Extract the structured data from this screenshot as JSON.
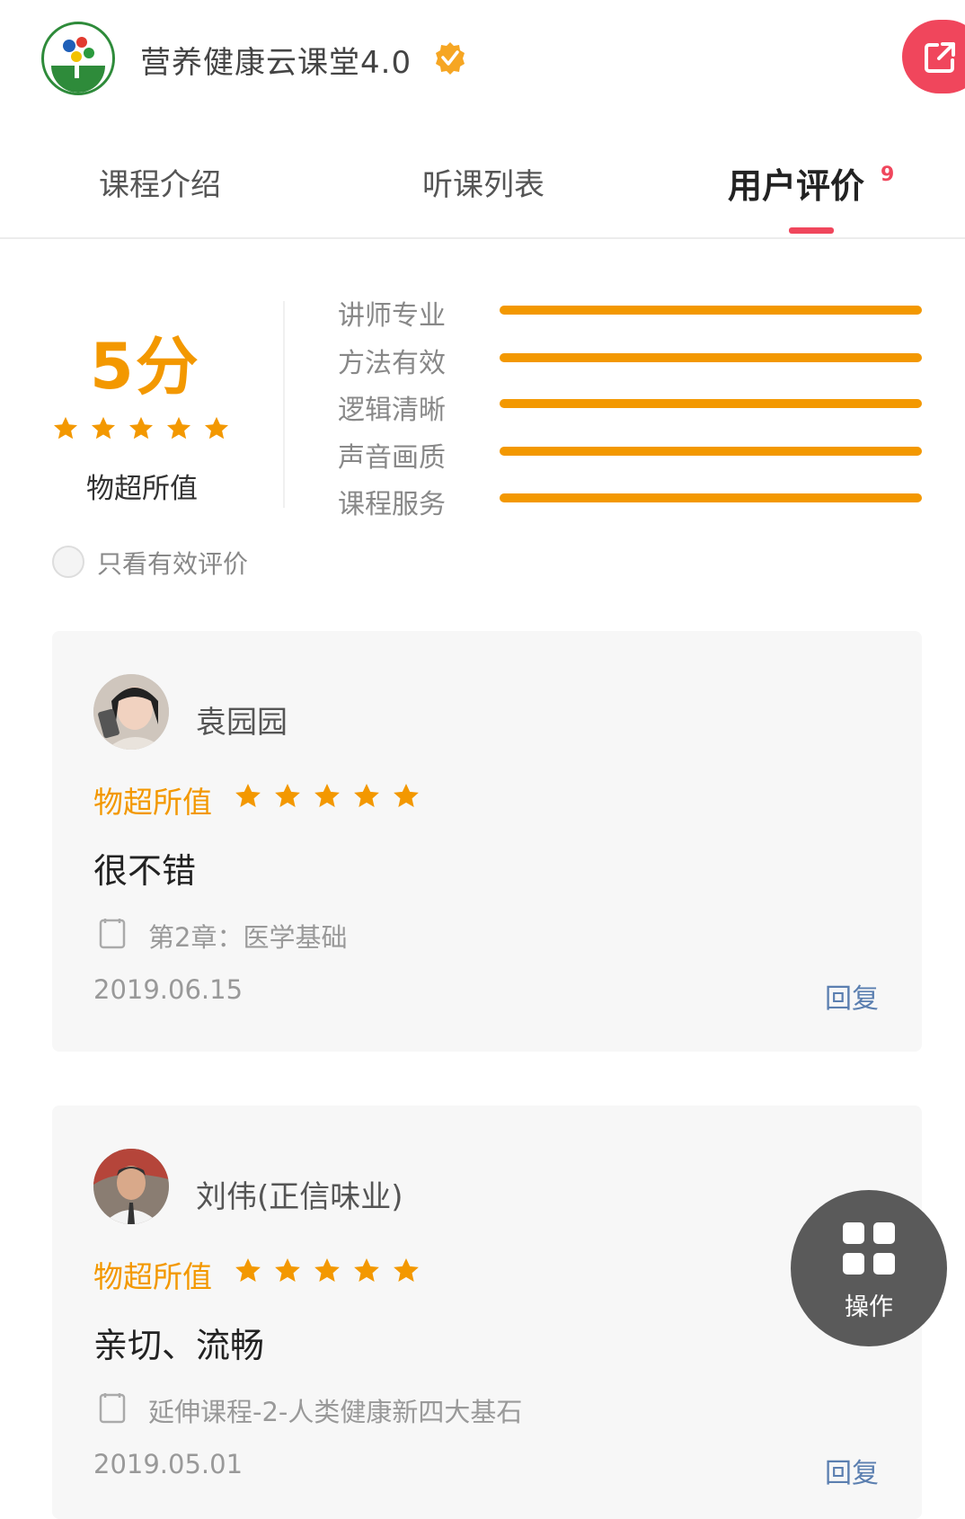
{
  "header": {
    "title": "营养健康云课堂4.0"
  },
  "tabs": [
    {
      "label": "课程介绍"
    },
    {
      "label": "听课列表"
    },
    {
      "label": "用户评价",
      "badge": "9",
      "active": true
    }
  ],
  "summary": {
    "score": "5分",
    "stars": 5,
    "label": "物超所值",
    "metrics": [
      {
        "label": "讲师专业",
        "value": 1.0
      },
      {
        "label": "方法有效",
        "value": 1.0
      },
      {
        "label": "逻辑清晰",
        "value": 1.0
      },
      {
        "label": "声音画质",
        "value": 1.0
      },
      {
        "label": "课程服务",
        "value": 1.0
      }
    ],
    "filter_label": "只看有效评价"
  },
  "reviews": [
    {
      "user": "袁园园",
      "tag": "物超所值",
      "stars": 5,
      "text": "很不错",
      "chapter": "第2章：医学基础",
      "date": "2019.06.15",
      "reply": "回复"
    },
    {
      "user": "刘伟(正信味业)",
      "tag": "物超所值",
      "stars": 5,
      "text": "亲切、流畅",
      "chapter": "延伸课程-2-人类健康新四大基石",
      "date": "2019.05.01",
      "reply": "回复"
    }
  ],
  "float_button": {
    "label": "操作"
  },
  "colors": {
    "accent": "#f39800",
    "brand_red": "#f0465c",
    "link": "#5b7fb0"
  }
}
